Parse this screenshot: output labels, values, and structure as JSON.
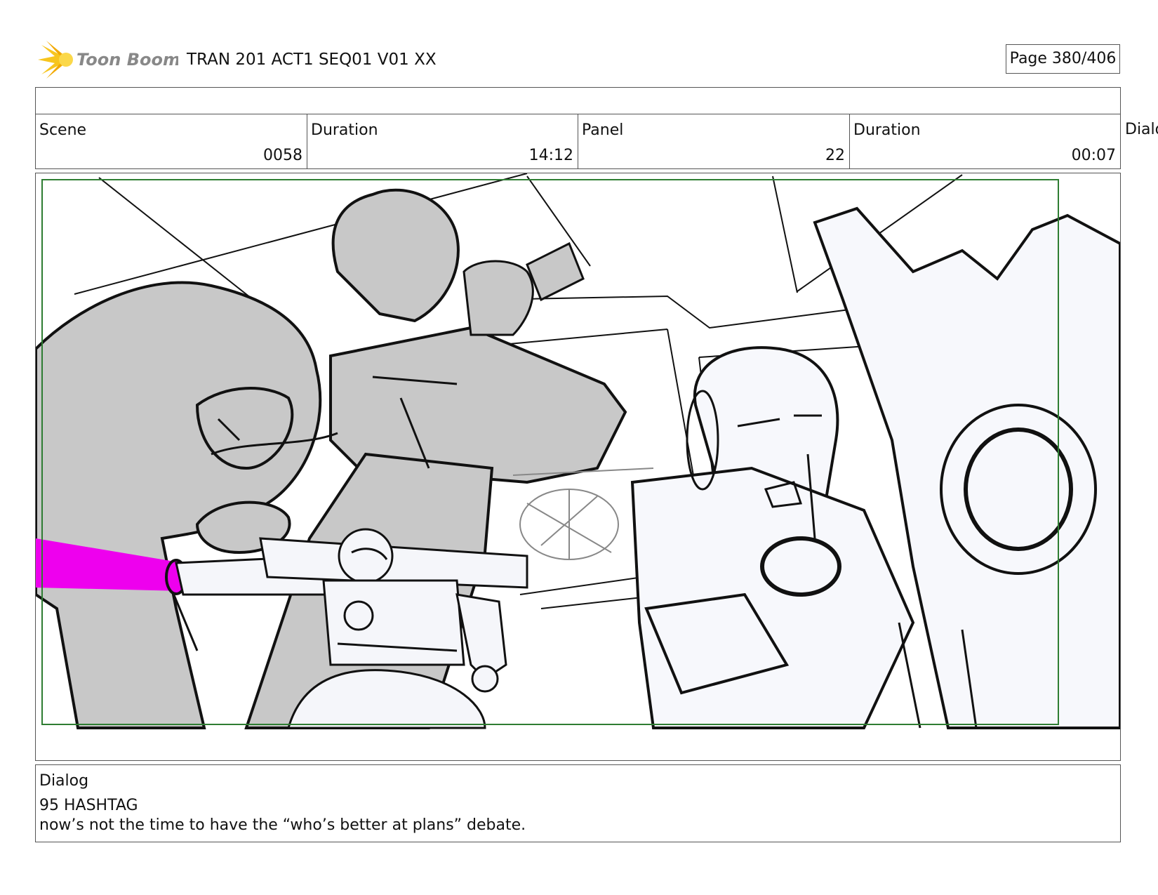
{
  "header": {
    "logo_text": "Toon Boom",
    "project_title": "TRAN 201 ACT1 SEQ01 V01 XX",
    "page_label": "Page 380/406"
  },
  "info": {
    "scene_label": "Scene",
    "scene_value": "0058",
    "scene_duration_label": "Duration",
    "scene_duration_value": "14:12",
    "panel_label": "Panel",
    "panel_value": "22",
    "panel_duration_label": "Duration",
    "panel_duration_value": "00:07",
    "overflow_label": "Dialog"
  },
  "dialog": {
    "label": "Dialog",
    "speaker": "95 HASHTAG",
    "line": "now’s not the time to have the “who’s better at plans” debate."
  },
  "colors": {
    "safe_frame": "#2e7d32",
    "laser": "#ee00ee",
    "sketch_fill": "#c8c8c8",
    "logo_star": "#f7c51e"
  }
}
